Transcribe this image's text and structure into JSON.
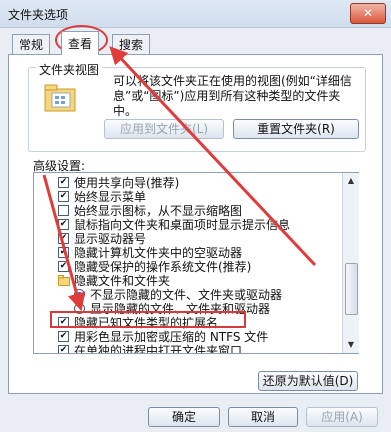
{
  "window": {
    "title": "文件夹选项",
    "close_label": "✕"
  },
  "tabs": [
    {
      "label": "常规",
      "active": false
    },
    {
      "label": "查看",
      "active": true
    },
    {
      "label": "搜索",
      "active": false
    }
  ],
  "folder_views": {
    "group_title": "文件夹视图",
    "description": "可以将该文件夹正在使用的视图(例如“详细信息”或“图标”)应用到所有这种类型的文件夹中。",
    "apply_button": "应用到文件夹(L)",
    "reset_button": "重置文件夹(R)"
  },
  "advanced": {
    "label": "高级设置:",
    "items": [
      {
        "type": "checkbox",
        "checked": true,
        "label": "使用共享向导(推荐)"
      },
      {
        "type": "checkbox",
        "checked": true,
        "label": "始终显示菜单"
      },
      {
        "type": "checkbox",
        "checked": false,
        "label": "始终显示图标，从不显示缩略图"
      },
      {
        "type": "checkbox",
        "checked": true,
        "label": "鼠标指向文件夹和桌面项时显示提示信息"
      },
      {
        "type": "checkbox",
        "checked": true,
        "label": "显示驱动器号"
      },
      {
        "type": "checkbox",
        "checked": true,
        "label": "隐藏计算机文件夹中的空驱动器"
      },
      {
        "type": "checkbox",
        "checked": true,
        "label": "隐藏受保护的操作系统文件(推荐)"
      },
      {
        "type": "folder",
        "label": "隐藏文件和文件夹"
      },
      {
        "type": "radio",
        "checked": true,
        "label": "不显示隐藏的文件、文件夹或驱动器"
      },
      {
        "type": "radio",
        "checked": false,
        "label": "显示隐藏的文件、文件夹和驱动器"
      },
      {
        "type": "checkbox",
        "checked": true,
        "label": "隐藏已知文件类型的扩展名"
      },
      {
        "type": "checkbox",
        "checked": true,
        "label": "用彩色显示加密或压缩的 NTFS 文件"
      },
      {
        "type": "checkbox",
        "checked": true,
        "label": "在单独的进程中打开文件夹窗口"
      }
    ]
  },
  "restore_button": "还原为默认值(D)",
  "footer": {
    "ok": "确定",
    "cancel": "取消",
    "apply": "应用(A)"
  },
  "colors": {
    "annotation_red": "#e03b3b"
  }
}
